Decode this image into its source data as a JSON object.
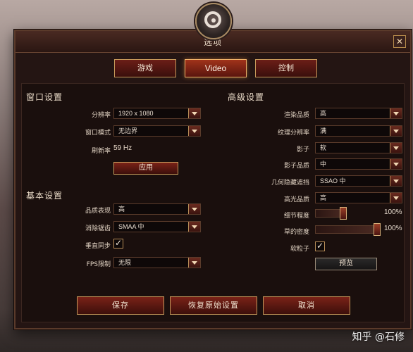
{
  "window": {
    "title": "选项",
    "close_label": "✕"
  },
  "tabs": [
    {
      "label": "游戏",
      "active": false
    },
    {
      "label": "Video",
      "active": true
    },
    {
      "label": "控制",
      "active": false
    }
  ],
  "left": {
    "window_settings": {
      "title": "窗口设置",
      "resolution": {
        "label": "分辨率",
        "value": "1920 x 1080"
      },
      "window_mode": {
        "label": "窗口模式",
        "value": "无边界"
      },
      "refresh_rate": {
        "label": "刷新率",
        "value": "59 Hz"
      },
      "apply_button": "应用"
    },
    "basic_settings": {
      "title": "基本设置",
      "quality": {
        "label": "品质表现",
        "value": "高"
      },
      "anti_aliasing": {
        "label": "消除锯齿",
        "value": "SMAA 中"
      },
      "vsync": {
        "label": "垂直同步",
        "checked": true
      },
      "fps_limit": {
        "label": "FPS限制",
        "value": "无限"
      }
    }
  },
  "right": {
    "advanced_settings": {
      "title": "高级设置",
      "render_quality": {
        "label": "渲染品质",
        "value": "高"
      },
      "texture_resolution": {
        "label": "纹理分辨率",
        "value": "满"
      },
      "shadows": {
        "label": "影子",
        "value": "软"
      },
      "shadow_quality": {
        "label": "影子品质",
        "value": "中"
      },
      "ambient_occlusion": {
        "label": "几何隐藏遮挡",
        "value": "SSAO 中"
      },
      "highlight_quality": {
        "label": "高光品质",
        "value": "高"
      },
      "detail_level": {
        "label": "细节程度",
        "value_percent": 100,
        "value_text": "100%"
      },
      "grass_density": {
        "label": "草的密度",
        "value_percent": 100,
        "value_text": "100%"
      },
      "soft_particles": {
        "label": "软粒子",
        "checked": true
      },
      "preview_button": "预览"
    }
  },
  "footer": {
    "save": "保存",
    "restore_defaults": "恢复原始设置",
    "cancel": "取消"
  },
  "watermark": "知乎 @石修",
  "colors": {
    "accent": "#c79a5b",
    "panel_bg": "#1a0f0d",
    "button_red": "#7a2217"
  },
  "icons": {
    "logo": "gear-logo-icon",
    "dropdown": "chevron-down-icon",
    "check": "check-icon",
    "close": "close-icon"
  }
}
